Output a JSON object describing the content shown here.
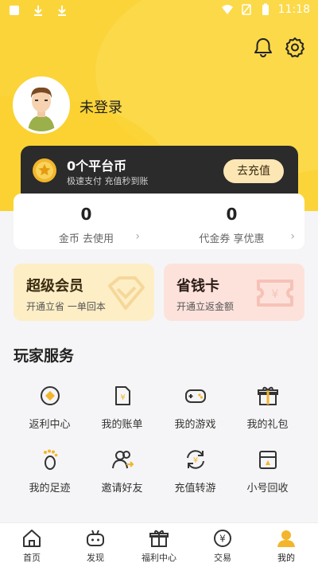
{
  "status_bar": {
    "time": "11:18"
  },
  "profile": {
    "login_label": "未登录"
  },
  "coin_card": {
    "title": "0个平台币",
    "subtitle": "极速支付 充值秒到账",
    "recharge_button": "去充值"
  },
  "balances": [
    {
      "value": "0",
      "label": "金币 去使用"
    },
    {
      "value": "0",
      "label": "代金券 享优惠"
    }
  ],
  "promo_cards": [
    {
      "title": "超级会员",
      "subtitle": "开通立省 一单回本"
    },
    {
      "title": "省钱卡",
      "subtitle": "开通立返金额"
    }
  ],
  "player_services": {
    "title": "玩家服务",
    "items": [
      {
        "label": "返利中心",
        "icon": "rebate-icon"
      },
      {
        "label": "我的账单",
        "icon": "bill-icon"
      },
      {
        "label": "我的游戏",
        "icon": "gamepad-icon"
      },
      {
        "label": "我的礼包",
        "icon": "gift-icon"
      },
      {
        "label": "我的足迹",
        "icon": "footprint-icon"
      },
      {
        "label": "邀请好友",
        "icon": "invite-icon"
      },
      {
        "label": "充值转游",
        "icon": "transfer-icon"
      },
      {
        "label": "小号回收",
        "icon": "recycle-icon"
      }
    ]
  },
  "tabbar": [
    {
      "label": "首页",
      "icon": "home-icon"
    },
    {
      "label": "发现",
      "icon": "discover-icon"
    },
    {
      "label": "福利中心",
      "icon": "welfare-icon"
    },
    {
      "label": "交易",
      "icon": "trade-icon"
    },
    {
      "label": "我的",
      "icon": "profile-icon",
      "active": true
    }
  ],
  "colors": {
    "brand_yellow": "#fbd43a",
    "dark_card": "#2b2b2b",
    "vip_bg": "#fdeec6",
    "saver_bg": "#fde2dc"
  }
}
